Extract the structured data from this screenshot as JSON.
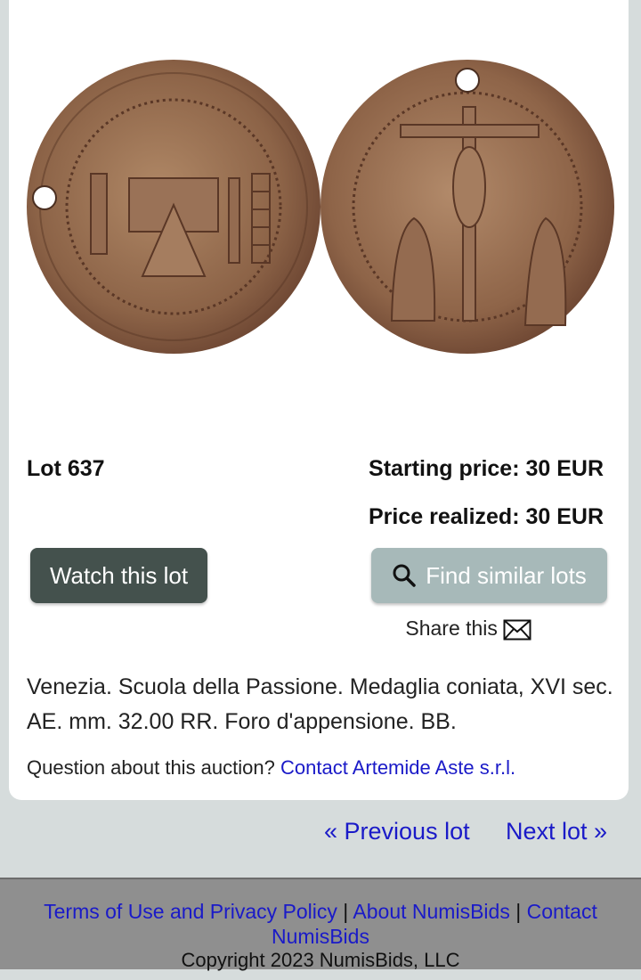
{
  "lot": {
    "number_label": "Lot 637",
    "starting_price": "Starting price: 30 EUR",
    "price_realized": "Price realized: 30 EUR",
    "description": "Venezia. Scuola della Passione. Medaglia coniata, XVI sec. AE. mm. 32.00 RR. Foro d'appensione. BB."
  },
  "actions": {
    "watch_label": "Watch this lot",
    "find_similar_label": "Find similar lots",
    "share_label": "Share this lot:"
  },
  "contact": {
    "question": "Question about this auction?",
    "link": "Contact Artemide Aste s.r.l."
  },
  "navigation": {
    "previous": "« Previous lot",
    "next": "Next lot »"
  },
  "footer": {
    "terms": "Terms of Use and Privacy Policy",
    "separator": "|",
    "about": "About NumisBids",
    "contact": "Contact NumisBids",
    "copyright": "Copyright 2023 NumisBids, LLC"
  },
  "colors": {
    "page_background": "#d6dcdc",
    "watch_button": "#44514d",
    "find_button": "#a7b9b9",
    "link": "#1a1ac8",
    "footer_background": "#8f8f8f"
  }
}
